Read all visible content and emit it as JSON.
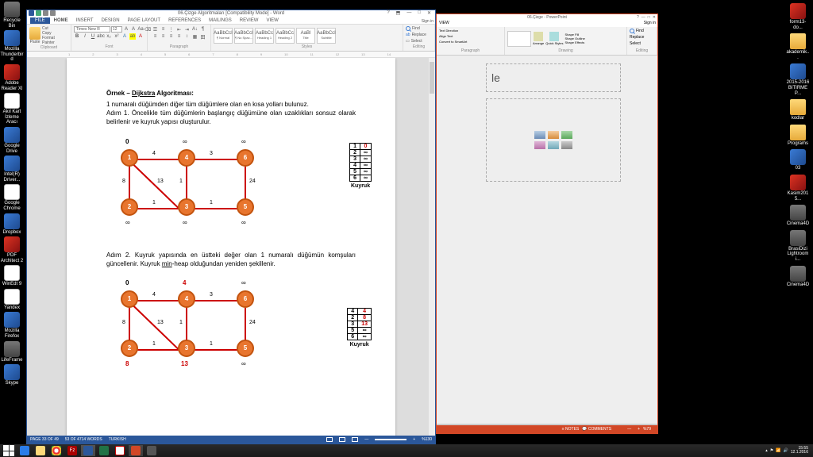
{
  "desktop_left": [
    {
      "label": "Recycle Bin",
      "cls": "gray"
    },
    {
      "label": "Mozilla Thunderbird",
      "cls": "blue"
    },
    {
      "label": "Adobe Reader XI",
      "cls": ""
    },
    {
      "label": "Akıl Kart İzleme Aracı",
      "cls": "white"
    },
    {
      "label": "Google Drive",
      "cls": "blue"
    },
    {
      "label": "Intel(R) Driver...",
      "cls": "blue"
    },
    {
      "label": "Google Chrome",
      "cls": "white"
    },
    {
      "label": "Dropbox",
      "cls": "blue"
    },
    {
      "label": "PDF Architect 2",
      "cls": ""
    },
    {
      "label": "WinEdt 9",
      "cls": "white"
    },
    {
      "label": "Yandex",
      "cls": "white"
    },
    {
      "label": "Mozilla Firefox",
      "cls": "blue"
    },
    {
      "label": "LifeFrame",
      "cls": "gray"
    },
    {
      "label": "Skype",
      "cls": "blue"
    }
  ],
  "desktop_right": [
    {
      "label": "form13-do...",
      "cls": ""
    },
    {
      "label": "akademik...",
      "cls": "folder"
    },
    {
      "label": "2015-2016 BITIRME P...",
      "cls": "blue"
    },
    {
      "label": "kodlar",
      "cls": "folder"
    },
    {
      "label": "Programs",
      "cls": "folder"
    },
    {
      "label": "03",
      "cls": "blue"
    },
    {
      "label": "Kasim2015...",
      "cls": ""
    },
    {
      "label": "Cinema4D",
      "cls": "gray"
    },
    {
      "label": "BrasiDizi Lightroom i...",
      "cls": "gray"
    },
    {
      "label": "Cinema4D",
      "cls": "gray"
    }
  ],
  "word": {
    "title": "06.Çizge Algoritmaları [Compatibility Mode] - Word",
    "tabs": [
      "HOME",
      "INSERT",
      "DESIGN",
      "PAGE LAYOUT",
      "REFERENCES",
      "MAILINGS",
      "REVIEW",
      "VIEW"
    ],
    "file": "FILE",
    "signin": "Sign in",
    "clipboard": {
      "label": "Clipboard",
      "paste": "Paste",
      "cut": "Cut",
      "copy": "Copy",
      "fp": "Format Painter"
    },
    "font": {
      "label": "Font",
      "name": "Times New R",
      "size": "12"
    },
    "para": {
      "label": "Paragraph"
    },
    "styles": {
      "label": "Styles",
      "st": [
        {
          "t": "AaBbCcI",
          "n": "¶ Normal"
        },
        {
          "t": "AaBbCcI",
          "n": "¶ No Spac..."
        },
        {
          "t": "AaBbCc",
          "n": "Heading 1"
        },
        {
          "t": "AaBbCc",
          "n": "Heading 2"
        },
        {
          "t": "AaBl",
          "n": "Title"
        },
        {
          "t": "AaBbCcI",
          "n": "Subtitle"
        }
      ]
    },
    "editing": {
      "label": "Editing",
      "find": "Find",
      "replace": "Replace",
      "select": "Select"
    },
    "status": {
      "page": "PAGE 33 OF 49",
      "words": "53 OF 4714 WORDS",
      "lang": "TURKISH",
      "zoom": "%130"
    },
    "doc": {
      "h1": "Örnek – ",
      "h1u": "Dijkstra",
      "h1b": " Algoritması:",
      "p1": "1 numaralı düğümden diğer tüm düğümlere olan en kısa yolları bulunuz.",
      "p2": "Adım 1. Öncelikle tüm düğümlerin başlangıç düğümüne olan uzaklıkları sonsuz olarak belirlenir ve kuyruk yapısı oluşturulur.",
      "p3": "Adım 2. Kuyruk yapısında en üstteki değer olan 1 numaralı düğümün komşuları güncellenir. Kuyruk ",
      "p3u": "min",
      "p3b": "-heap olduğundan yeniden şekillenir.",
      "queue_title": "Kuyruk",
      "q1_head": [
        [
          "1",
          "0"
        ],
        [
          "2",
          "∞"
        ],
        [
          "3",
          "∞"
        ],
        [
          "4",
          "∞"
        ],
        [
          "5",
          "∞"
        ],
        [
          "6",
          "∞"
        ]
      ],
      "q2_head": [
        [
          "4",
          "4"
        ],
        [
          "2",
          "8"
        ],
        [
          "3",
          "13"
        ],
        [
          "5",
          "∞"
        ],
        [
          "6",
          "∞"
        ]
      ],
      "head1": [
        "0",
        "∞",
        "∞"
      ],
      "foot1": [
        "∞",
        "∞",
        "∞"
      ],
      "head2": [
        "0",
        "4",
        "∞"
      ],
      "foot2": [
        "8",
        "13",
        "∞"
      ]
    }
  },
  "pp": {
    "title": "06.Çizge - PowerPoint",
    "view": "VIEW",
    "signin": "Sign in",
    "groups": {
      "paragraph": "Paragraph",
      "drawing": "Drawing",
      "editing": "Editing"
    },
    "ribbon": {
      "td": "Text Direction",
      "at": "Align Text",
      "sa": "Convert to SmartArt",
      "sf": "Shape Fill",
      "so": "Shape Outline",
      "se": "Shape Effects",
      "arr": "Arrange",
      "qs": "Quick Styles",
      "find": "Find",
      "replace": "Replace",
      "select": "Select"
    },
    "slide": {
      "title_ph": "le"
    },
    "status": {
      "notes": "NOTES",
      "comments": "COMMENTS",
      "zoom": "%79"
    }
  },
  "taskbar": {
    "time": "15:55",
    "date": "12.1.2016"
  }
}
